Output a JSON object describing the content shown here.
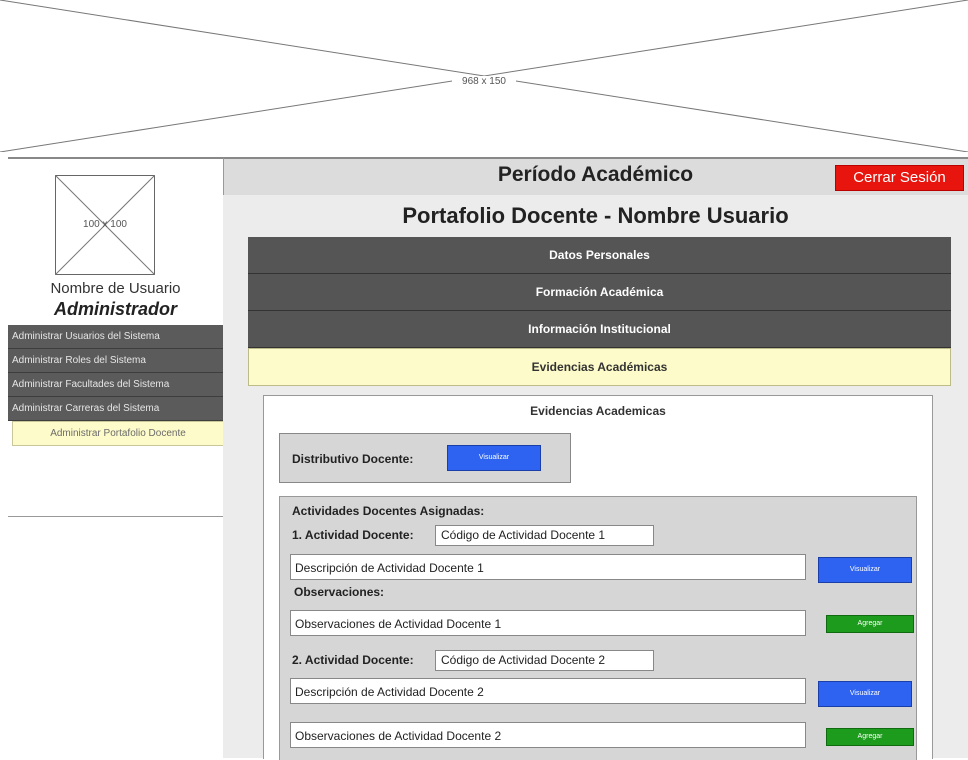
{
  "banner": {
    "label": "968 x 150"
  },
  "header": {
    "title": "Período Académico",
    "logout_label": "Cerrar Sesión"
  },
  "sidebar": {
    "avatar_label": "100 x 100",
    "username": "Nombre de Usuario",
    "role": "Administrador",
    "items": [
      {
        "label": "Administrar Usuarios del Sistema"
      },
      {
        "label": "Administrar Roles del Sistema"
      },
      {
        "label": "Administrar Facultades del Sistema"
      },
      {
        "label": "Administrar Carreras del Sistema"
      },
      {
        "label": "Administrar Portafolio Docente"
      }
    ]
  },
  "main": {
    "title": "Portafolio Docente - Nombre Usuario",
    "tabs": [
      {
        "label": "Datos Personales"
      },
      {
        "label": "Formación Académica"
      },
      {
        "label": "Información Institucional"
      },
      {
        "label": "Evidencias Académicas"
      }
    ],
    "panel": {
      "title": "Evidencias Academicas",
      "distributivo_label": "Distributivo Docente:",
      "view_label": "Visualizar",
      "add_label": "Agregar",
      "activities_heading": "Actividades Docentes Asignadas:",
      "activities": [
        {
          "label": "1. Actividad Docente:",
          "code": "Código de Actividad Docente 1",
          "description": "Descripción de Actividad Docente 1",
          "observations_label": "Observaciones:",
          "observations": "Observaciones de Actividad Docente 1"
        },
        {
          "label": "2. Actividad Docente:",
          "code": "Código de Actividad Docente 2",
          "description": "Descripción de Actividad Docente 2",
          "observations": "Observaciones de Actividad Docente 2"
        }
      ]
    }
  },
  "colors": {
    "logout": "#e8150f",
    "tab_active": "#fdfbc9",
    "button_view": "#2d63f0",
    "button_add": "#1c9b1c",
    "menu": "#5b5b5b"
  }
}
